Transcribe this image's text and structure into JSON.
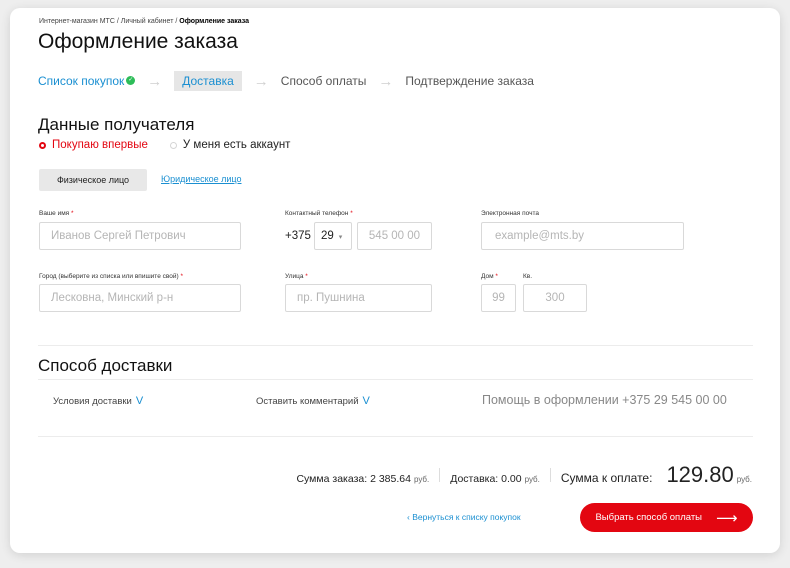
{
  "breadcrumb": {
    "items": [
      "Интернет-магазин МТС",
      "Личный кабинет"
    ],
    "current": "Оформление заказа",
    "sep": " / "
  },
  "page_title": "Оформление заказа",
  "steps": [
    {
      "label": "Список покупок",
      "state": "done"
    },
    {
      "label": "Доставка",
      "state": "active"
    },
    {
      "label": "Способ оплаты",
      "state": "pending"
    },
    {
      "label": "Подтверждение заказа",
      "state": "pending"
    }
  ],
  "recipient": {
    "title": "Данные получателя",
    "radio_new": "Покупаю впервые",
    "radio_account": "У меня есть аккаунт",
    "type_individual": "Физическое лицо",
    "type_legal": "Юридическое лицо"
  },
  "form": {
    "name": {
      "label": "Ваше имя",
      "req": "*",
      "placeholder": "Иванов Сергей Петрович"
    },
    "phone": {
      "label": "Контактный телефон",
      "req": "*",
      "country_code": "+375",
      "operator": "29",
      "placeholder": "545 00 00"
    },
    "email": {
      "label": "Электронная почта",
      "placeholder": "example@mts.by"
    },
    "city": {
      "label": "Город (выберите из списка или впишите свой)",
      "req": "*",
      "placeholder": "Лесковна, Минский р-н"
    },
    "street": {
      "label": "Улица",
      "req": "*",
      "placeholder": "пр. Пушнина"
    },
    "house": {
      "label": "Дом",
      "req": "*",
      "placeholder": "99"
    },
    "apt": {
      "label": "Кв.",
      "placeholder": "300"
    }
  },
  "delivery": {
    "title": "Способ доставки",
    "conditions": "Условия доставки",
    "comment": "Оставить комментарий",
    "chevron": "V",
    "help": "Помощь в оформлении +375 29 545 00 00"
  },
  "totals": {
    "order_label": "Сумма заказа:",
    "order_value": "2 385.64",
    "delivery_label": "Доставка:",
    "delivery_value": "0.00",
    "pay_label": "Сумма к оплате:",
    "pay_value": "129.80",
    "currency": "руб."
  },
  "actions": {
    "back": "‹ Вернуться к списку покупок",
    "next": "Выбрать способ оплаты",
    "next_arrow": "⟶"
  },
  "colors": {
    "accent": "#e30611",
    "link": "#1a8fd1",
    "success": "#2ebd59"
  }
}
